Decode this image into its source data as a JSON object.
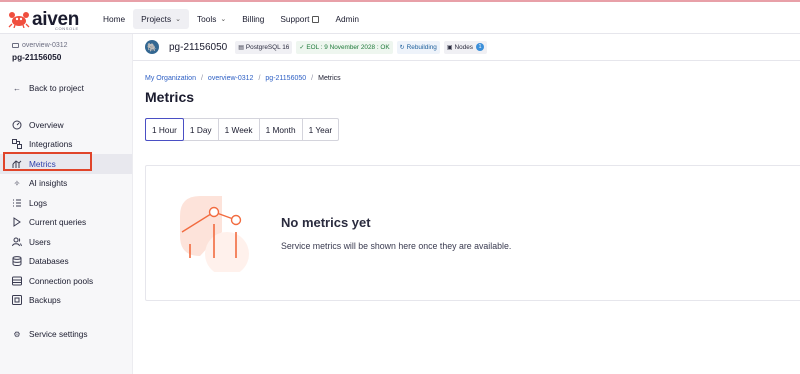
{
  "header": {
    "logo_text": "aiven",
    "logo_sub": "CONSOLE",
    "nav": [
      {
        "label": "Home"
      },
      {
        "label": "Projects",
        "chevron": true,
        "active": true
      },
      {
        "label": "Tools",
        "chevron": true
      },
      {
        "label": "Billing"
      },
      {
        "label": "Support",
        "external": true
      },
      {
        "label": "Admin"
      }
    ]
  },
  "sidebar": {
    "project": "overview-0312",
    "service": "pg-21156050",
    "back_label": "Back to project",
    "items": [
      {
        "label": "Overview",
        "icon": "gauge-icon"
      },
      {
        "label": "Integrations",
        "icon": "integrations-icon"
      },
      {
        "label": "Metrics",
        "icon": "metrics-icon",
        "active": true
      },
      {
        "label": "AI insights",
        "icon": "sparkle-icon"
      },
      {
        "label": "Logs",
        "icon": "list-icon"
      },
      {
        "label": "Current queries",
        "icon": "play-icon"
      },
      {
        "label": "Users",
        "icon": "users-icon"
      },
      {
        "label": "Databases",
        "icon": "database-icon"
      },
      {
        "label": "Connection pools",
        "icon": "pool-icon"
      },
      {
        "label": "Backups",
        "icon": "backup-icon"
      }
    ],
    "settings_label": "Service settings"
  },
  "service_bar": {
    "name": "pg-21156050",
    "engine": "PostgreSQL 16",
    "eol": "EOL : 9 November 2028 : OK",
    "status": "Rebuilding",
    "nodes_label": "Nodes",
    "nodes_count": "1"
  },
  "breadcrumbs": [
    "My Organization",
    "overview-0312",
    "pg-21156050",
    "Metrics"
  ],
  "page_title": "Metrics",
  "ranges": [
    {
      "label": "1 Hour",
      "active": true
    },
    {
      "label": "1 Day"
    },
    {
      "label": "1 Week"
    },
    {
      "label": "1 Month"
    },
    {
      "label": "1 Year"
    }
  ],
  "empty_state": {
    "title": "No metrics yet",
    "subtitle": "Service metrics will be shown here once they are available."
  },
  "colors": {
    "accent": "#4a4fc4",
    "link": "#2d5fc4",
    "highlight_box": "#e0442a",
    "illustration": "#f26b3f"
  }
}
